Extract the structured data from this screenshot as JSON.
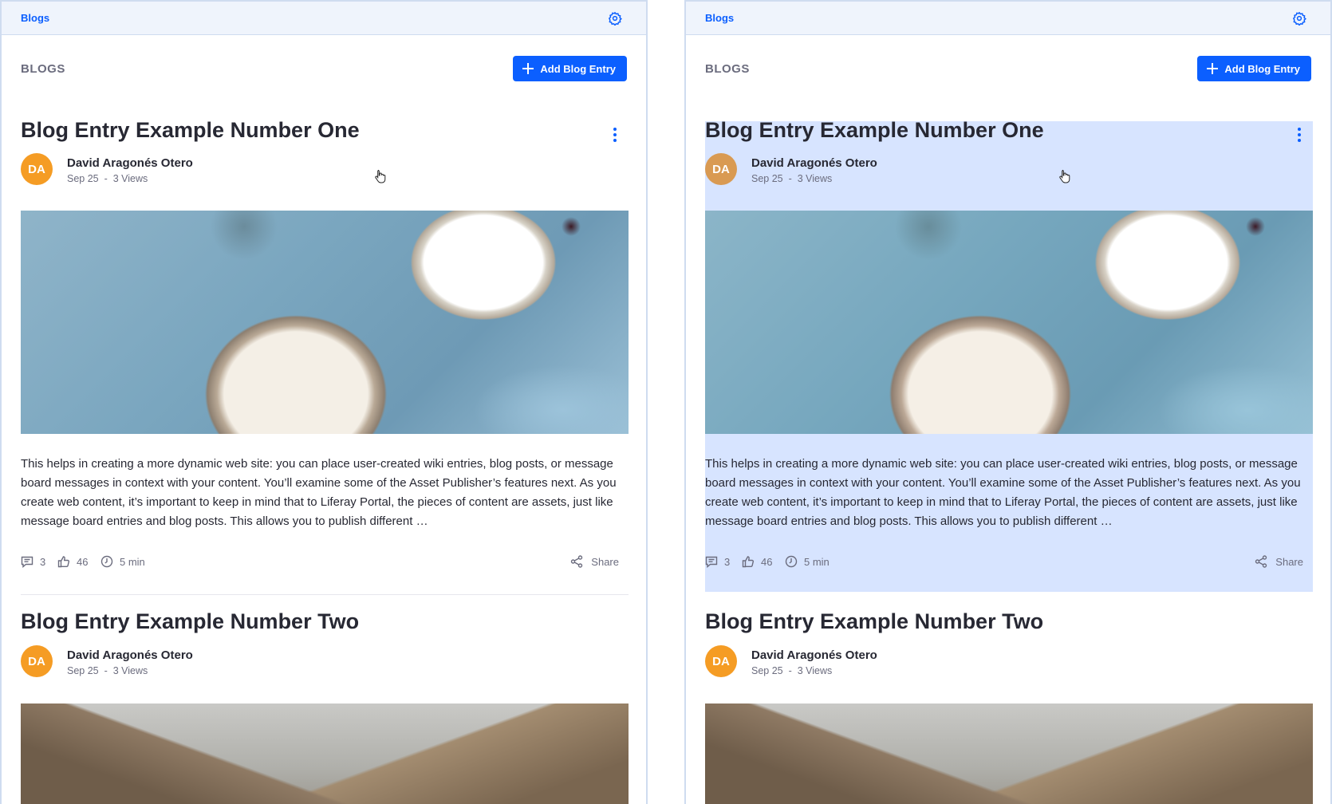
{
  "panels": [
    {
      "id": "left",
      "topbar_title": "Blogs",
      "section_title": "Blogs",
      "add_button_label": "Add Blog Entry",
      "entries": [
        {
          "title": "Blog Entry Example Number One",
          "avatar_initials": "DA",
          "author": "David Aragonés Otero",
          "date": "Sep 25",
          "views": "3 Views",
          "excerpt": "This helps in creating a more dynamic web site: you can place user-created wiki entries, blog posts, or message board messages in context with your content. You’ll examine some of the Asset Publisher’s features next. As you create web content, it’s important to keep in mind that to Liferay Portal, the pieces of content are assets, just like message board entries and blog posts. This allows you to publish different …",
          "comments": "3",
          "likes": "46",
          "read_time": "5 min",
          "share_label": "Share"
        },
        {
          "title": "Blog Entry Example Number Two",
          "avatar_initials": "DA",
          "author": "David Aragonés Otero",
          "date": "Sep 25",
          "views": "3 Views"
        }
      ]
    },
    {
      "id": "right",
      "highlighted_entry": 0,
      "topbar_title": "Blogs",
      "section_title": "Blogs",
      "add_button_label": "Add Blog Entry",
      "entries": [
        {
          "title": "Blog Entry Example Number One",
          "avatar_initials": "DA",
          "author": "David Aragonés Otero",
          "date": "Sep 25",
          "views": "3 Views",
          "excerpt": "This helps in creating a more dynamic web site: you can place user-created wiki entries, blog posts, or message board messages in context with your content. You’ll examine some of the Asset Publisher’s features next. As you create web content, it’s important to keep in mind that to Liferay Portal, the pieces of content are assets, just like message board entries and blog posts. This allows you to publish different …",
          "comments": "3",
          "likes": "46",
          "read_time": "5 min",
          "share_label": "Share"
        },
        {
          "title": "Blog Entry Example Number Two",
          "avatar_initials": "DA",
          "author": "David Aragonés Otero",
          "date": "Sep 25",
          "views": "3 Views"
        }
      ]
    }
  ],
  "icons": {
    "settings": "gear-icon",
    "actions": "kebab-icon",
    "add": "plus-icon",
    "comments": "comment-icon",
    "likes": "thumbs-up-icon",
    "read_time": "clock-icon",
    "share": "share-icon",
    "cursor": "hand-cursor-icon"
  },
  "colors": {
    "accent": "#0b5fff",
    "avatar": "#f59c24",
    "topbar_bg": "#eff4fc",
    "highlight": "#c9dbff",
    "text": "#272833",
    "muted": "#6b6c7e"
  }
}
